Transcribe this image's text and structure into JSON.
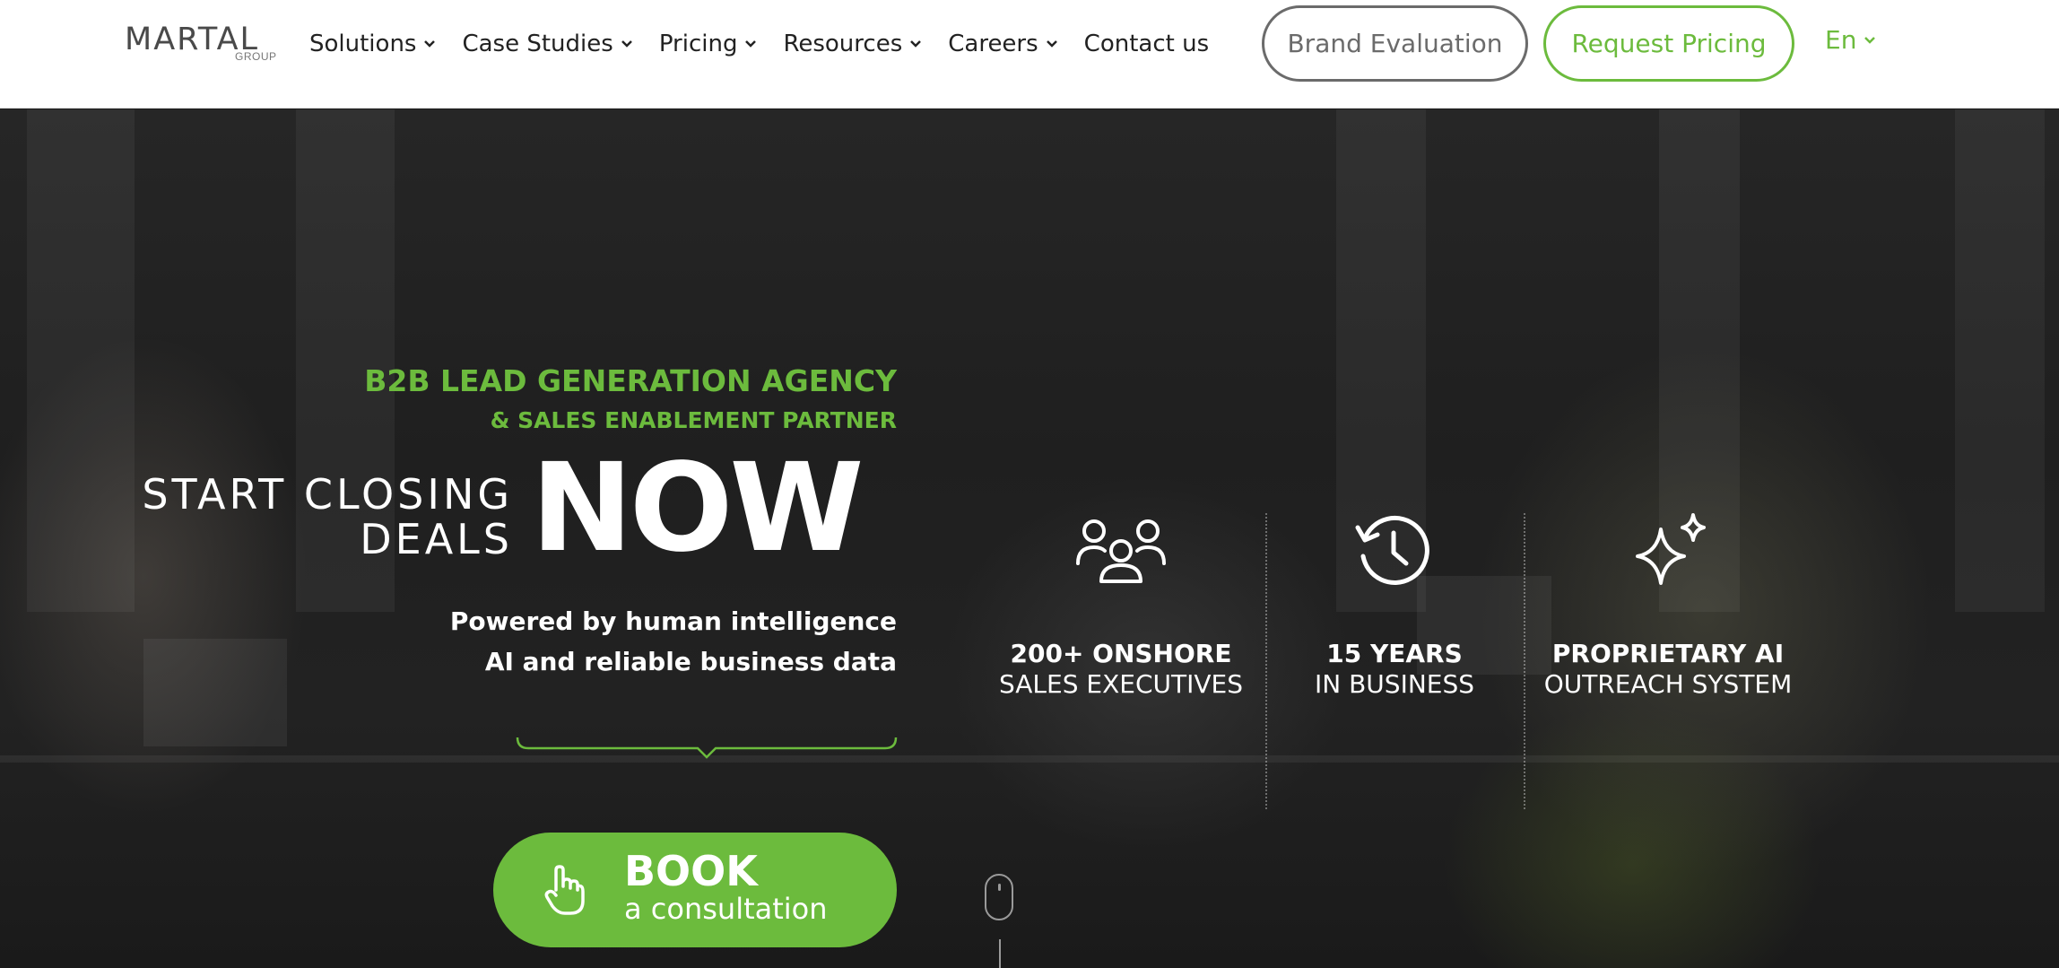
{
  "brand": {
    "logo_text": "MARTAL",
    "logo_sub": "GROUP"
  },
  "nav": {
    "items": [
      {
        "label": "Solutions",
        "has_dropdown": true
      },
      {
        "label": "Case Studies",
        "has_dropdown": true
      },
      {
        "label": "Pricing",
        "has_dropdown": true
      },
      {
        "label": "Resources",
        "has_dropdown": true
      },
      {
        "label": "Careers",
        "has_dropdown": true
      },
      {
        "label": "Contact us",
        "has_dropdown": false
      }
    ],
    "brand_evaluation": "Brand Evaluation",
    "request_pricing": "Request Pricing",
    "language": "En"
  },
  "hero": {
    "tagline_1": "B2B LEAD GENERATION AGENCY",
    "tagline_2": "& SALES ENABLEMENT PARTNER",
    "headline_line1": "START CLOSING",
    "headline_line2": "DEALS",
    "headline_emphasis": "NOW",
    "powered_line1": "Powered by human intelligence",
    "powered_line2": "AI and reliable business data",
    "cta_title": "BOOK",
    "cta_sub": "a consultation"
  },
  "stats": [
    {
      "icon": "people-group-icon",
      "bold": "200+ ONSHORE",
      "normal": "SALES EXECUTIVES"
    },
    {
      "icon": "history-clock-icon",
      "bold": "15 YEARS",
      "normal": "IN BUSINESS"
    },
    {
      "icon": "sparkles-icon",
      "bold": "PROPRIETARY AI",
      "normal": "OUTREACH SYSTEM"
    }
  ],
  "colors": {
    "accent": "#6cbb3d",
    "header_bg": "#ffffff",
    "hero_overlay": "#1f1f1f",
    "outline_gray": "#6b6b6b"
  }
}
